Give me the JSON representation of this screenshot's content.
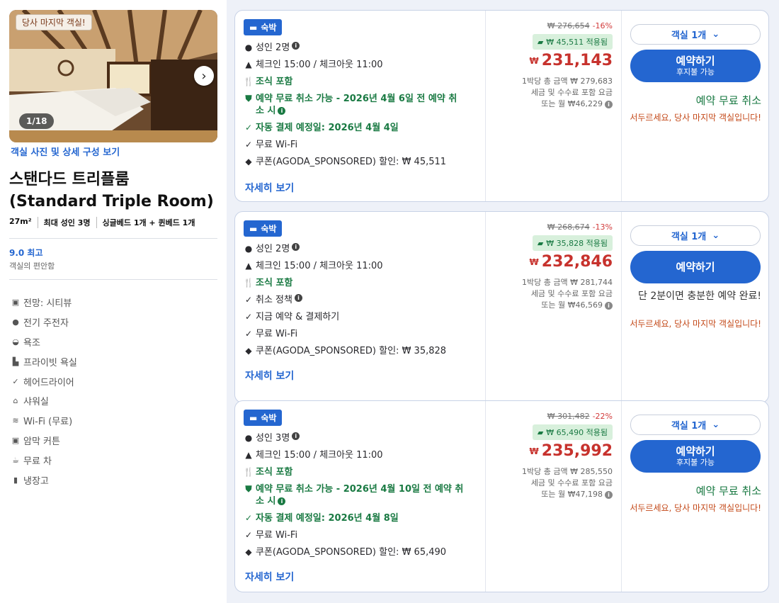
{
  "left": {
    "last_room_badge": "당사 마지막 객실!",
    "photo_counter": "1/18",
    "photo_link": "객실 사진 및 상세 구성 보기",
    "room_title_line1": "스탠다드 트리플룸",
    "room_title_line2": "(Standard Triple Room)",
    "specs": [
      "27m²",
      "최대 성인 3명",
      "싱글베드 1개 + 퀸베드 1개"
    ],
    "score": "9.0 최고",
    "score_sub": "객실의 편안함",
    "amenities": [
      {
        "label": "전망: 시티뷰",
        "icon": "city-view-icon"
      },
      {
        "label": "전기 주전자",
        "icon": "kettle-icon"
      },
      {
        "label": "욕조",
        "icon": "bathtub-icon"
      },
      {
        "label": "프라이빗 욕실",
        "icon": "private-bath-icon"
      },
      {
        "label": "헤어드라이어",
        "icon": "check-icon"
      },
      {
        "label": "샤워실",
        "icon": "shower-icon"
      },
      {
        "label": "Wi-Fi (무료)",
        "icon": "wifi-icon"
      },
      {
        "label": "암막 커튼",
        "icon": "curtain-icon"
      },
      {
        "label": "무료 차",
        "icon": "tea-icon"
      },
      {
        "label": "냉장고",
        "icon": "fridge-icon"
      }
    ]
  },
  "cards": [
    {
      "tag": "숙박",
      "guests": "성인 2명",
      "checkin": "체크인 15:00 / 체크아웃 11:00",
      "breakfast": "조식 포함",
      "cancel_line1": "예약 무료 취소 가능 - 2026년 4월 6일 전 예약 취",
      "cancel_line2": "소 시",
      "payment": "자동 결제 예정일: 2026년 4월 4일",
      "wifi": "무료 Wi-Fi",
      "coupon_text": "쿠폰(AGODA_SPONSORED) 할인: ₩ 45,511",
      "details": "자세히 보기",
      "orig_price": "₩ 276,654",
      "discount_pct": "-16%",
      "coupon_applied": "₩ 45,511 적용됨",
      "currency": "₩",
      "price": "231,143",
      "note1": "1박당 총 금액 ₩ 279,683",
      "note2": "세금 및 수수료 포함 요금",
      "note3": "또는 월 ₩46,229",
      "room_select": "객실 1개",
      "book_main": "예약하기",
      "book_sub": "후지불 가능",
      "free_cancel": "예약 무료 취소",
      "hurry": "서두르세요, 당사 마지막 객실입니다!"
    },
    {
      "tag": "숙박",
      "guests": "성인 2명",
      "checkin": "체크인 15:00 / 체크아웃 11:00",
      "breakfast": "조식 포함",
      "cancel_policy": "취소 정책",
      "pay_now": "지금 예약 & 결제하기",
      "wifi": "무료 Wi-Fi",
      "coupon_text": "쿠폰(AGODA_SPONSORED) 할인: ₩ 35,828",
      "details": "자세히 보기",
      "orig_price": "₩ 268,674",
      "discount_pct": "-13%",
      "coupon_applied": "₩ 35,828 적용됨",
      "currency": "₩",
      "price": "232,846",
      "note1": "1박당 총 금액 ₩ 281,744",
      "note2": "세금 및 수수료 포함 요금",
      "note3": "또는 월 ₩46,569",
      "room_select": "객실 1개",
      "book_main": "예약하기",
      "quick": "단 2분이면 충분한 예약 완료!",
      "hurry": "서두르세요, 당사 마지막 객실입니다!"
    },
    {
      "tag": "숙박",
      "guests": "성인 3명",
      "checkin": "체크인 15:00 / 체크아웃 11:00",
      "breakfast": "조식 포함",
      "cancel_line1": "예약 무료 취소 가능 - 2026년 4월 10일 전 예약 취",
      "cancel_line2": "소 시",
      "payment": "자동 결제 예정일: 2026년 4월 8일",
      "wifi": "무료 Wi-Fi",
      "coupon_text": "쿠폰(AGODA_SPONSORED) 할인: ₩ 65,490",
      "details": "자세히 보기",
      "orig_price": "₩ 301,482",
      "discount_pct": "-22%",
      "coupon_applied": "₩ 65,490 적용됨",
      "currency": "₩",
      "price": "235,992",
      "note1": "1박당 총 금액 ₩ 285,550",
      "note2": "세금 및 수수료 포함 요금",
      "note3": "또는 월 ₩47,198",
      "room_select": "객실 1개",
      "book_main": "예약하기",
      "book_sub": "후지불 가능",
      "free_cancel": "예약 무료 취소",
      "hurry": "서두르세요, 당사 마지막 객실입니다!"
    }
  ],
  "colors": {
    "accent": "#2466d0",
    "price": "#c7322d",
    "green": "#1a7a43",
    "hurry": "#c44a1a"
  }
}
